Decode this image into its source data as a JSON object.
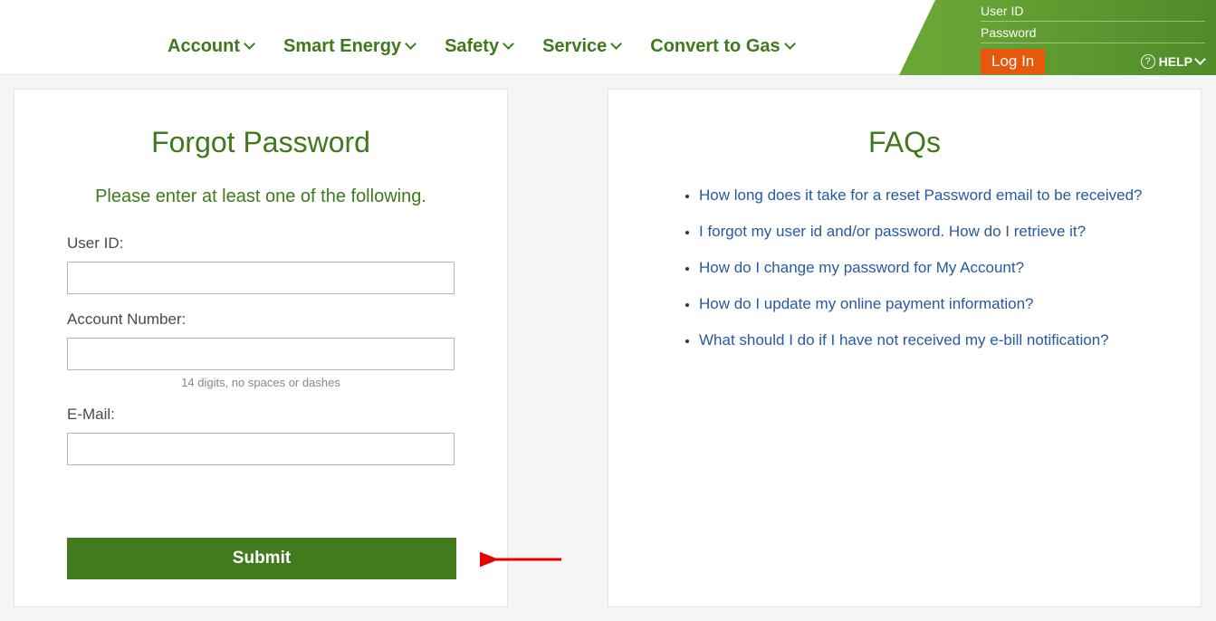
{
  "nav": {
    "items": [
      {
        "label": "Account"
      },
      {
        "label": "Smart Energy"
      },
      {
        "label": "Safety"
      },
      {
        "label": "Service"
      },
      {
        "label": "Convert to Gas"
      }
    ]
  },
  "login": {
    "userid_label": "User ID",
    "password_label": "Password",
    "login_button": "Log In",
    "help_label": "HELP"
  },
  "forgot": {
    "title": "Forgot Password",
    "subtitle": "Please enter at least one of the following.",
    "userid_label": "User ID:",
    "account_label": "Account Number:",
    "account_hint": "14 digits, no spaces or dashes",
    "email_label": "E-Mail:",
    "submit_label": "Submit"
  },
  "faq": {
    "title": "FAQs",
    "items": [
      "How long does it take for a reset Password email to be received?",
      "I forgot my user id and/or password. How do I retrieve it?",
      "How do I change my password for My Account?",
      "How do I update my online payment information?",
      "What should I do if I have not received my e-bill notification?"
    ]
  }
}
